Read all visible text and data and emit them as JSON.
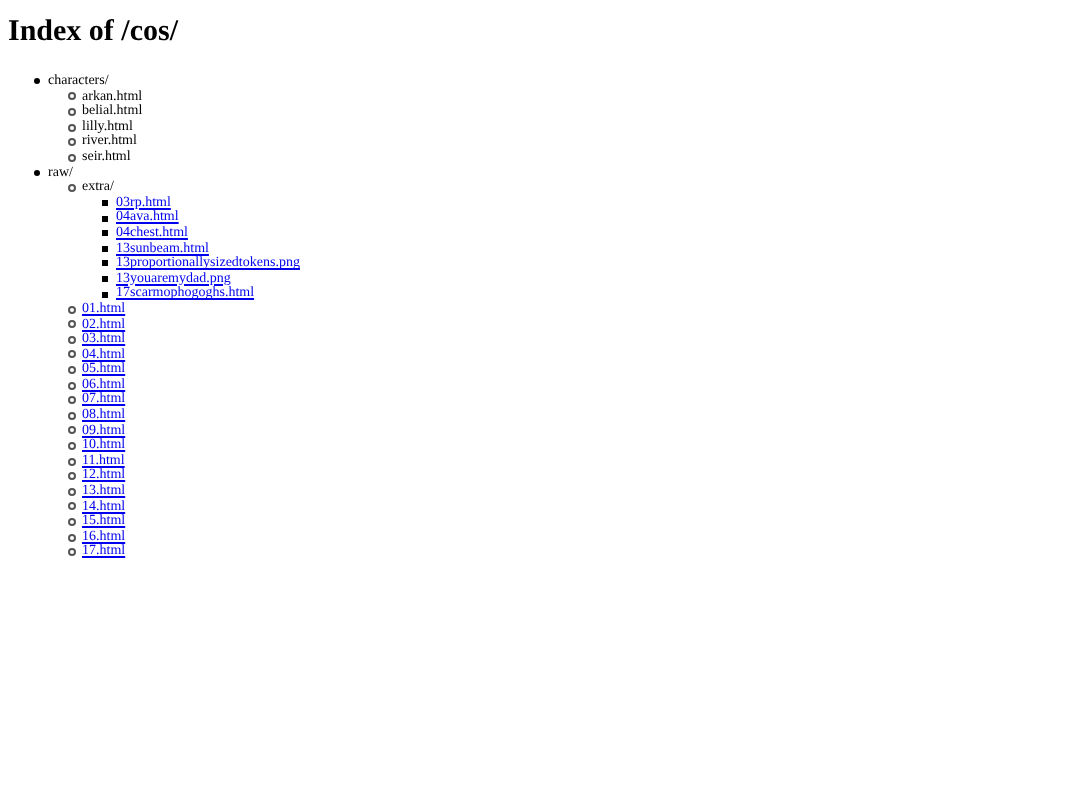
{
  "title": "Index of /cos/",
  "tree": [
    {
      "label": "characters/",
      "kind": "text",
      "children": [
        {
          "label": "arkan.html",
          "kind": "text"
        },
        {
          "label": "belial.html",
          "kind": "text"
        },
        {
          "label": "lilly.html",
          "kind": "text"
        },
        {
          "label": "river.html",
          "kind": "text"
        },
        {
          "label": "seir.html",
          "kind": "text"
        }
      ]
    },
    {
      "label": "raw/",
      "kind": "text",
      "children": [
        {
          "label": "extra/",
          "kind": "text",
          "children": [
            {
              "label": "03rp.html",
              "kind": "link"
            },
            {
              "label": "04ava.html",
              "kind": "link"
            },
            {
              "label": "04chest.html",
              "kind": "link"
            },
            {
              "label": "13sunbeam.html",
              "kind": "link"
            },
            {
              "label": "13proportionallysizedtokens.png",
              "kind": "link"
            },
            {
              "label": "13youaremydad.png",
              "kind": "link"
            },
            {
              "label": "17scarmophogoghs.html",
              "kind": "link"
            }
          ]
        },
        {
          "label": "01.html",
          "kind": "link"
        },
        {
          "label": "02.html",
          "kind": "link"
        },
        {
          "label": "03.html",
          "kind": "link"
        },
        {
          "label": "04.html",
          "kind": "link"
        },
        {
          "label": "05.html",
          "kind": "link"
        },
        {
          "label": "06.html",
          "kind": "link"
        },
        {
          "label": "07.html",
          "kind": "link"
        },
        {
          "label": "08.html",
          "kind": "link"
        },
        {
          "label": "09.html",
          "kind": "link"
        },
        {
          "label": "10.html",
          "kind": "link"
        },
        {
          "label": "11.html",
          "kind": "link"
        },
        {
          "label": "12.html",
          "kind": "link"
        },
        {
          "label": "13.html",
          "kind": "link"
        },
        {
          "label": "14.html",
          "kind": "link"
        },
        {
          "label": "15.html",
          "kind": "link"
        },
        {
          "label": "16.html",
          "kind": "link"
        },
        {
          "label": "17.html",
          "kind": "link"
        }
      ]
    }
  ]
}
